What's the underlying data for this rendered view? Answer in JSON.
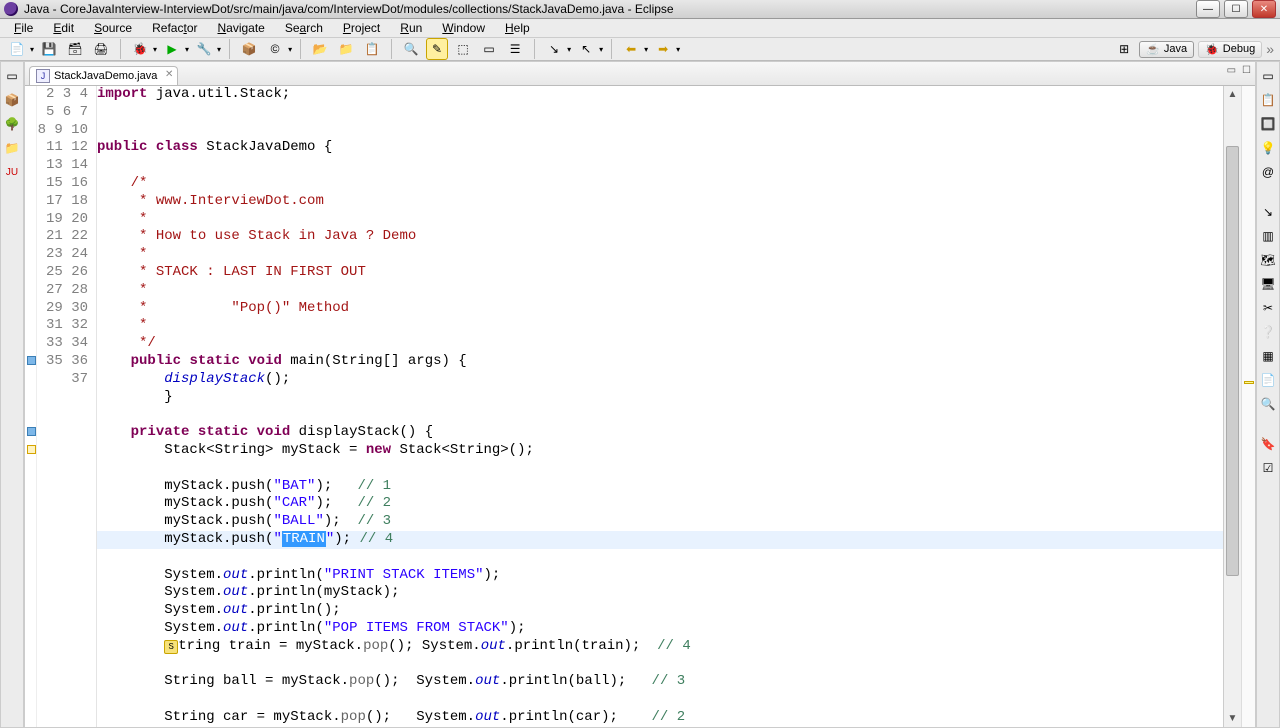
{
  "window": {
    "title": "Java - CoreJavaInterview-InterviewDot/src/main/java/com/InterviewDot/modules/collections/StackJavaDemo.java - Eclipse"
  },
  "menu": [
    "File",
    "Edit",
    "Source",
    "Refactor",
    "Navigate",
    "Search",
    "Project",
    "Run",
    "Window",
    "Help"
  ],
  "perspective": {
    "java": "Java",
    "debug": "Debug"
  },
  "tab": {
    "label": "StackJavaDemo.java"
  },
  "gutter_start": 2,
  "gutter_end": 37,
  "code_lines": [
    {
      "n": 2,
      "tokens": [
        {
          "c": "k",
          "t": "import"
        },
        {
          "t": " java.util.Stack;"
        }
      ]
    },
    {
      "n": 3,
      "tokens": []
    },
    {
      "n": 4,
      "tokens": []
    },
    {
      "n": 5,
      "tokens": [
        {
          "c": "k",
          "t": "public"
        },
        {
          "t": " "
        },
        {
          "c": "k",
          "t": "class"
        },
        {
          "t": " StackJavaDemo {"
        }
      ]
    },
    {
      "n": 6,
      "tokens": []
    },
    {
      "n": 7,
      "indent": 4,
      "tokens": [
        {
          "c": "jdoc",
          "t": "/*"
        }
      ]
    },
    {
      "n": 8,
      "indent": 4,
      "tokens": [
        {
          "c": "jdoc",
          "t": " * www.InterviewDot.com"
        }
      ]
    },
    {
      "n": 9,
      "indent": 4,
      "tokens": [
        {
          "c": "jdoc",
          "t": " *"
        }
      ]
    },
    {
      "n": 10,
      "indent": 4,
      "tokens": [
        {
          "c": "jdoc",
          "t": " * How to use Stack in Java ? Demo"
        }
      ]
    },
    {
      "n": 11,
      "indent": 4,
      "tokens": [
        {
          "c": "jdoc",
          "t": " *"
        }
      ]
    },
    {
      "n": 12,
      "indent": 4,
      "tokens": [
        {
          "c": "jdoc",
          "t": " * STACK : LAST IN FIRST OUT"
        }
      ]
    },
    {
      "n": 13,
      "indent": 4,
      "tokens": [
        {
          "c": "jdoc",
          "t": " *"
        }
      ]
    },
    {
      "n": 14,
      "indent": 4,
      "tokens": [
        {
          "c": "jdoc",
          "t": " *          \"Pop()\" Method"
        }
      ]
    },
    {
      "n": 15,
      "indent": 4,
      "tokens": [
        {
          "c": "jdoc",
          "t": " *"
        }
      ]
    },
    {
      "n": 16,
      "indent": 4,
      "tokens": [
        {
          "c": "jdoc",
          "t": " */"
        }
      ]
    },
    {
      "n": 17,
      "indent": 4,
      "tokens": [
        {
          "c": "k",
          "t": "public"
        },
        {
          "t": " "
        },
        {
          "c": "k",
          "t": "static"
        },
        {
          "t": " "
        },
        {
          "c": "k",
          "t": "void"
        },
        {
          "t": " main(String[] args) {"
        }
      ]
    },
    {
      "n": 18,
      "indent": 8,
      "tokens": [
        {
          "c": "it",
          "t": "displayStack"
        },
        {
          "t": "();"
        }
      ]
    },
    {
      "n": 19,
      "indent": 8,
      "tokens": [
        {
          "t": "}"
        }
      ]
    },
    {
      "n": 20,
      "tokens": []
    },
    {
      "n": 21,
      "indent": 4,
      "tokens": [
        {
          "c": "k",
          "t": "private"
        },
        {
          "t": " "
        },
        {
          "c": "k",
          "t": "static"
        },
        {
          "t": " "
        },
        {
          "c": "k",
          "t": "void"
        },
        {
          "t": " displayStack() {"
        }
      ]
    },
    {
      "n": 22,
      "indent": 8,
      "tokens": [
        {
          "t": "Stack<String> myStack = "
        },
        {
          "c": "k",
          "t": "new"
        },
        {
          "t": " Stack<String>();"
        }
      ]
    },
    {
      "n": 23,
      "tokens": []
    },
    {
      "n": 24,
      "indent": 8,
      "tokens": [
        {
          "t": "myStack.push("
        },
        {
          "c": "str",
          "t": "\"BAT\""
        },
        {
          "t": ");   "
        },
        {
          "c": "cmt",
          "t": "// 1"
        }
      ]
    },
    {
      "n": 25,
      "indent": 8,
      "tokens": [
        {
          "t": "myStack.push("
        },
        {
          "c": "str",
          "t": "\"CAR\""
        },
        {
          "t": ");   "
        },
        {
          "c": "cmt",
          "t": "// 2"
        }
      ]
    },
    {
      "n": 26,
      "indent": 8,
      "tokens": [
        {
          "t": "myStack.push("
        },
        {
          "c": "str",
          "t": "\"BALL\""
        },
        {
          "t": ");  "
        },
        {
          "c": "cmt",
          "t": "// 3"
        }
      ]
    },
    {
      "n": 27,
      "indent": 8,
      "curline": true,
      "tokens": [
        {
          "t": "myStack.push("
        },
        {
          "c": "str",
          "t": "\""
        },
        {
          "c": "selection",
          "t": "TRAIN"
        },
        {
          "c": "str",
          "t": "\""
        },
        {
          "t": "); "
        },
        {
          "c": "cmt",
          "t": "// 4"
        }
      ]
    },
    {
      "n": 28,
      "tokens": []
    },
    {
      "n": 29,
      "indent": 8,
      "tokens": [
        {
          "t": "System."
        },
        {
          "c": "it",
          "t": "out"
        },
        {
          "t": ".println("
        },
        {
          "c": "str",
          "t": "\"PRINT STACK ITEMS\""
        },
        {
          "t": ");"
        }
      ]
    },
    {
      "n": 30,
      "indent": 8,
      "tokens": [
        {
          "t": "System."
        },
        {
          "c": "it",
          "t": "out"
        },
        {
          "t": ".println(myStack);"
        }
      ]
    },
    {
      "n": 31,
      "indent": 8,
      "tokens": [
        {
          "t": "System."
        },
        {
          "c": "it",
          "t": "out"
        },
        {
          "t": ".println();"
        }
      ]
    },
    {
      "n": 32,
      "indent": 8,
      "tokens": [
        {
          "t": "System."
        },
        {
          "c": "it",
          "t": "out"
        },
        {
          "t": ".println("
        },
        {
          "c": "str",
          "t": "\"POP ITEMS FROM STACK\""
        },
        {
          "t": ");"
        }
      ]
    },
    {
      "n": 33,
      "indent": 8,
      "tokens": [
        {
          "caret": true
        },
        {
          "t": "tring train = myStack."
        },
        {
          "c": "annot",
          "t": "pop"
        },
        {
          "t": "(); System."
        },
        {
          "c": "it",
          "t": "out"
        },
        {
          "t": ".println(train);  "
        },
        {
          "c": "cmt",
          "t": "// 4"
        }
      ]
    },
    {
      "n": 34,
      "tokens": []
    },
    {
      "n": 35,
      "indent": 8,
      "tokens": [
        {
          "t": "String ball = myStack."
        },
        {
          "c": "annot",
          "t": "pop"
        },
        {
          "t": "();  System."
        },
        {
          "c": "it",
          "t": "out"
        },
        {
          "t": ".println(ball);   "
        },
        {
          "c": "cmt",
          "t": "// 3"
        }
      ]
    },
    {
      "n": 36,
      "tokens": []
    },
    {
      "n": 37,
      "indent": 8,
      "tokens": [
        {
          "t": "String car = myStack."
        },
        {
          "c": "annot",
          "t": "pop"
        },
        {
          "t": "();   System."
        },
        {
          "c": "it",
          "t": "out"
        },
        {
          "t": ".println(car);    "
        },
        {
          "c": "cmt",
          "t": "// 2"
        }
      ]
    }
  ]
}
